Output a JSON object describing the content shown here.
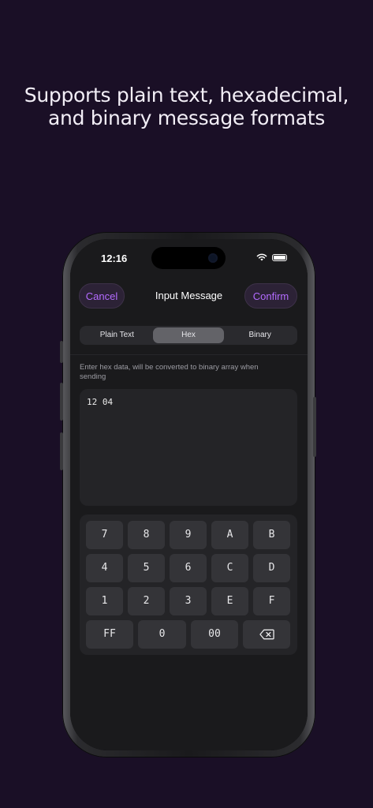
{
  "headline": {
    "line1": "Supports plain text, hexadecimal,",
    "line2": "and binary message formats"
  },
  "status_bar": {
    "time": "12:16",
    "icons": [
      "wifi-icon",
      "battery-icon"
    ]
  },
  "nav": {
    "cancel_label": "Cancel",
    "title": "Input Message",
    "confirm_label": "Confirm"
  },
  "format_tabs": {
    "selected": "Hex",
    "items": [
      {
        "label": "Plain Text"
      },
      {
        "label": "Hex"
      },
      {
        "label": "Binary"
      }
    ]
  },
  "hint": "Enter hex data, will be converted to binary array when sending",
  "input": {
    "value": "12 04"
  },
  "keypad": {
    "row1": [
      "7",
      "8",
      "9",
      "A",
      "B"
    ],
    "row2": [
      "4",
      "5",
      "6",
      "C",
      "D"
    ],
    "row3": [
      "1",
      "2",
      "3",
      "E",
      "F"
    ],
    "row4": [
      "FF",
      "0",
      "00"
    ],
    "delete_icon": "backspace-icon"
  },
  "colors": {
    "background": "#1a0f26",
    "accent": "#b36bff",
    "app_background": "#1a1a1c"
  }
}
